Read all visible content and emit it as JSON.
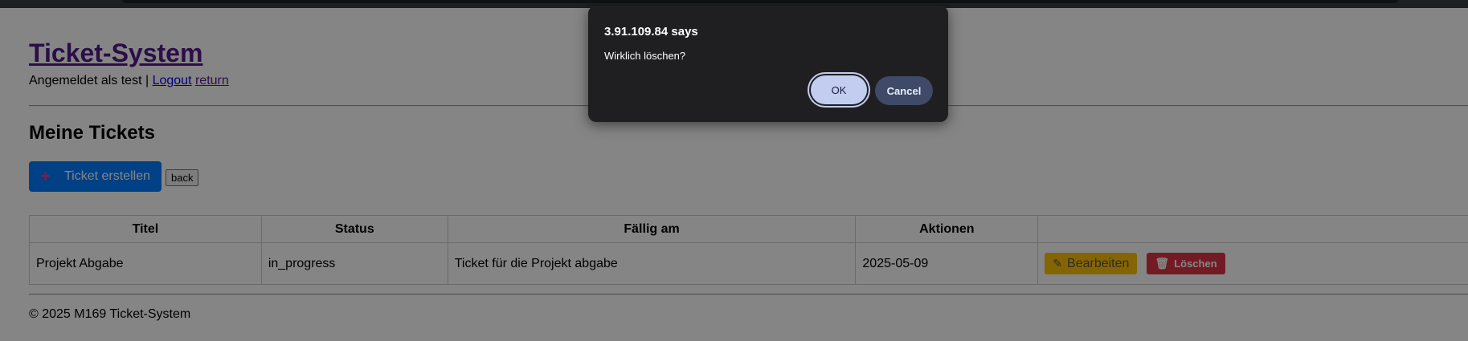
{
  "header": {
    "title": "Ticket-System",
    "logged_in_prefix": "Angemeldet als test |",
    "logout_label": "Logout",
    "return_label": "return"
  },
  "main": {
    "section_title": "Meine Tickets",
    "create_button_label": "Ticket erstellen",
    "create_button_icon": "plus-icon",
    "back_button_label": "back",
    "table": {
      "columns": [
        "Titel",
        "Status",
        "Fällig am",
        "Aktionen",
        ""
      ],
      "rows": [
        {
          "titel": "Projekt Abgabe",
          "status": "in_progress",
          "beschreibung": "Ticket für die Projekt abgabe",
          "faellig": "2025-05-09",
          "edit_label": "Bearbeiten",
          "delete_label": "Löschen"
        }
      ]
    }
  },
  "footer": {
    "text": "© 2025 M169 Ticket-System"
  },
  "dialog": {
    "origin": "3.91.109.84 says",
    "message": "Wirklich löschen?",
    "ok_label": "OK",
    "cancel_label": "Cancel"
  },
  "colors": {
    "create_button": "#007bff",
    "edit_button": "#ffc107",
    "delete_button": "#dc3545",
    "dialog_background": "#1f1f22",
    "ok_button": "#c2cdf0",
    "cancel_button": "#3e4a67"
  }
}
